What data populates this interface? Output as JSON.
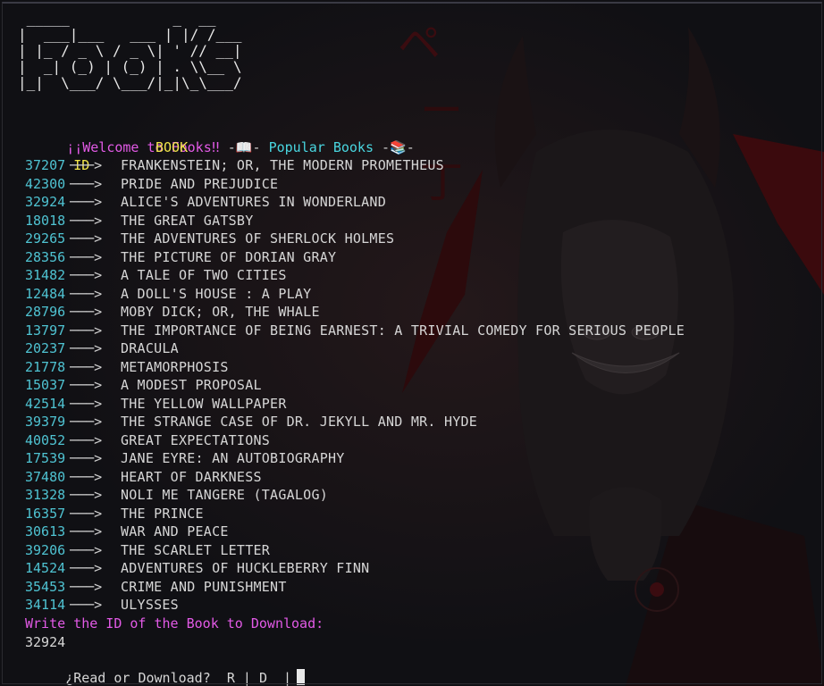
{
  "banner": {
    "ascii": " _____            _  __\n|  ___|___   ___ | |/ /___\n| |_ / _ \\ / _ \\| ' // __|\n|  _| (_) | (_) | . \\\\__ \\\n|_|  \\___/ \\___/|_|\\_\\___/"
  },
  "welcome": {
    "greeting": "¡¡Welcome to Fooks‼",
    "sep1": " -📖- ",
    "section": "Popular Books",
    "sep2": " -📚-"
  },
  "table_header": {
    "id_label": "ID",
    "book_label": "BOOK"
  },
  "arrow": "───>",
  "books": [
    {
      "id": "37207",
      "title": "FRANKENSTEIN; OR, THE MODERN PROMETHEUS"
    },
    {
      "id": "42300",
      "title": "PRIDE AND PREJUDICE"
    },
    {
      "id": "32924",
      "title": "ALICE'S ADVENTURES IN WONDERLAND"
    },
    {
      "id": "18018",
      "title": "THE GREAT GATSBY"
    },
    {
      "id": "29265",
      "title": "THE ADVENTURES OF SHERLOCK HOLMES"
    },
    {
      "id": "28356",
      "title": "THE PICTURE OF DORIAN GRAY"
    },
    {
      "id": "31482",
      "title": "A TALE OF TWO CITIES"
    },
    {
      "id": "12484",
      "title": "A DOLL'S HOUSE : A PLAY"
    },
    {
      "id": "28796",
      "title": "MOBY DICK; OR, THE WHALE"
    },
    {
      "id": "13797",
      "title": "THE IMPORTANCE OF BEING EARNEST: A TRIVIAL COMEDY FOR SERIOUS PEOPLE"
    },
    {
      "id": "20237",
      "title": "DRACULA"
    },
    {
      "id": "21778",
      "title": "METAMORPHOSIS"
    },
    {
      "id": "15037",
      "title": "A MODEST PROPOSAL"
    },
    {
      "id": "42514",
      "title": "THE YELLOW WALLPAPER"
    },
    {
      "id": "39379",
      "title": "THE STRANGE CASE OF DR. JEKYLL AND MR. HYDE"
    },
    {
      "id": "40052",
      "title": "GREAT EXPECTATIONS"
    },
    {
      "id": "17539",
      "title": "JANE EYRE: AN AUTOBIOGRAPHY"
    },
    {
      "id": "37480",
      "title": "HEART OF DARKNESS"
    },
    {
      "id": "31328",
      "title": "NOLI ME TANGERE (TAGALOG)"
    },
    {
      "id": "16357",
      "title": "THE PRINCE"
    },
    {
      "id": "30613",
      "title": "WAR AND PEACE"
    },
    {
      "id": "39206",
      "title": "THE SCARLET LETTER"
    },
    {
      "id": "14524",
      "title": "ADVENTURES OF HUCKLEBERRY FINN"
    },
    {
      "id": "35453",
      "title": "CRIME AND PUNISHMENT"
    },
    {
      "id": "34114",
      "title": "ULYSSES"
    }
  ],
  "prompt": {
    "question": "Write the ID of the Book to Download:",
    "entered_value": "32924",
    "choice_question": "¿Read or Download?",
    "option_read": "R",
    "option_sep": "|",
    "option_download": "D",
    "input_sep": "|"
  },
  "colors": {
    "magenta": "#e25ae6",
    "cyan": "#49d6e0",
    "yellow": "#f2e64a",
    "id_teal": "#4fc3d2",
    "background": "#101014",
    "art_red": "#5a0c10"
  }
}
